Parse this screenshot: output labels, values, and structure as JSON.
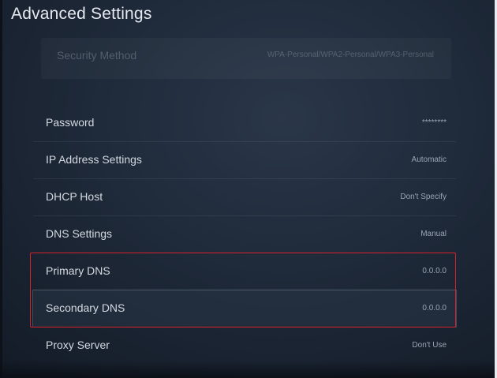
{
  "header": {
    "title": "Advanced Settings"
  },
  "security": {
    "label": "Security Method",
    "value": "WPA-Personal/WPA2-Personal/WPA3-Personal"
  },
  "settings": {
    "rows": [
      {
        "label": "Password",
        "value": "********"
      },
      {
        "label": "IP Address Settings",
        "value": "Automatic"
      },
      {
        "label": "DHCP Host",
        "value": "Don't Specify"
      },
      {
        "label": "DNS Settings",
        "value": "Manual"
      },
      {
        "label": "Primary DNS",
        "value": "0.0.0.0"
      },
      {
        "label": "Secondary DNS",
        "value": "0.0.0.0"
      },
      {
        "label": "Proxy Server",
        "value": "Don't Use"
      }
    ]
  },
  "colors": {
    "highlight": "#d8202a",
    "background": "#1b2533"
  }
}
